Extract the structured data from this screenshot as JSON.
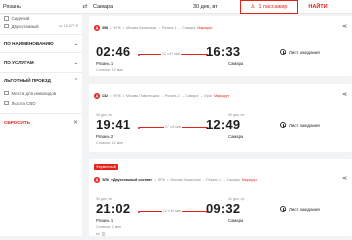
{
  "search": {
    "from": "Рязань",
    "to": "Самара",
    "date": "30 дек, вт",
    "passengers": "1 пассажир",
    "find_label": "НАЙТИ"
  },
  "sidebar": {
    "top_items": [
      {
        "label": "Сидячий",
        "price": ""
      },
      {
        "label": "Двухэтажный",
        "price": "от 16 677 ₽"
      }
    ],
    "sections": [
      {
        "title": "ПО НАИМЕНОВАНИЮ"
      },
      {
        "title": "ПО УСЛУГАМ"
      },
      {
        "title": "ЛЬГОТНЫЙ ПРОЕЗД"
      }
    ],
    "benefit_items": [
      "Места для инвалидов",
      "Льгота СВО"
    ],
    "reset_label": "СБРОСИТЬ"
  },
  "trains": [
    {
      "number": "398",
      "carrier": "ФПК",
      "route_prefix": "Москва Казанская → Рязань 1 → Самара",
      "route_link": "Маршрут",
      "dep_date": "30 дек, вт",
      "arr_date": "30 дек, вт",
      "dep_time": "02:46",
      "arr_time": "16:33",
      "duration": "13 ч 47 мин",
      "from_station": "Рязань 1",
      "to_station": "Самара",
      "stop": "Стоянка: 12 мин",
      "waitlist": "Лист ожидания"
    },
    {
      "number": "132",
      "carrier": "ФПК",
      "route_prefix": "Москва Павелецкая → Рязань 2 → Самара → Орск",
      "route_link": "Маршрут",
      "dep_date": "30 дек, вт",
      "arr_date": "30 дек, вт",
      "dep_time": "19:41",
      "arr_time": "12:49",
      "duration": "17 ч 8 мин",
      "from_station": "Рязань 2",
      "to_station": "Самара",
      "stop": "Стоянка: 12 мин",
      "waitlist": "Лист ожидания"
    },
    {
      "badge": "Фирменный",
      "number": "ЭЛ6",
      "name": "«Двухэтажный состав»",
      "carrier": "ФПК",
      "route_prefix": "Москва Казанская → Рязань 1 → Самара",
      "route_link": "Маршрут",
      "dep_date": "30 дек, вт",
      "arr_date": "31 дек, ср",
      "dep_time": "21:02",
      "arr_time": "09:32",
      "duration": "12 ч 30 мин",
      "from_station": "Рязань 1",
      "to_station": "Самара",
      "stop": "Стоянка: 2 мин",
      "waitlist": "Лист ожидания"
    }
  ],
  "colors": {
    "accent": "#e2231a",
    "background": "#f2f3f5",
    "card": "#ffffff"
  },
  "icons": [
    "swap-icon",
    "calendar-icon",
    "person-icon",
    "chevron-icon",
    "close-icon",
    "train-icon",
    "share-icon",
    "clock-icon"
  ]
}
